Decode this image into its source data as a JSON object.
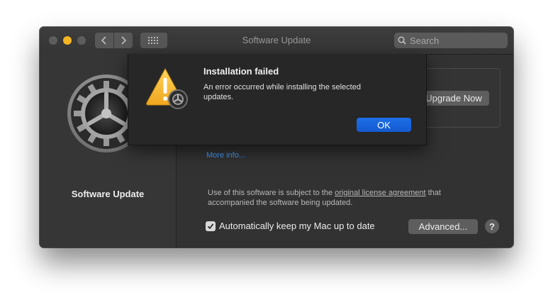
{
  "window": {
    "title": "Software Update",
    "search_placeholder": "Search"
  },
  "sidebar": {
    "title": "Software Update"
  },
  "main": {
    "upgrade_label": "Upgrade Now",
    "more_info_label": "More info...",
    "license": {
      "pre": "Use of this software is subject to the ",
      "link": "original license agreement",
      "post": " that accompanied the software being updated."
    },
    "auto_update_label": "Automatically keep my Mac up to date",
    "auto_update_checked": true,
    "advanced_label": "Advanced...",
    "help_label": "?"
  },
  "alert": {
    "title": "Installation failed",
    "message": "An error occurred while installing the selected updates.",
    "ok_label": "OK"
  },
  "colors": {
    "accent": "#1e6fe8",
    "link": "#419cff",
    "minimize": "#f5b520"
  },
  "icons": [
    "chevron-left-icon",
    "chevron-right-icon",
    "grid-icon",
    "search-icon",
    "gear-icon",
    "warning-icon",
    "checkmark-icon"
  ]
}
